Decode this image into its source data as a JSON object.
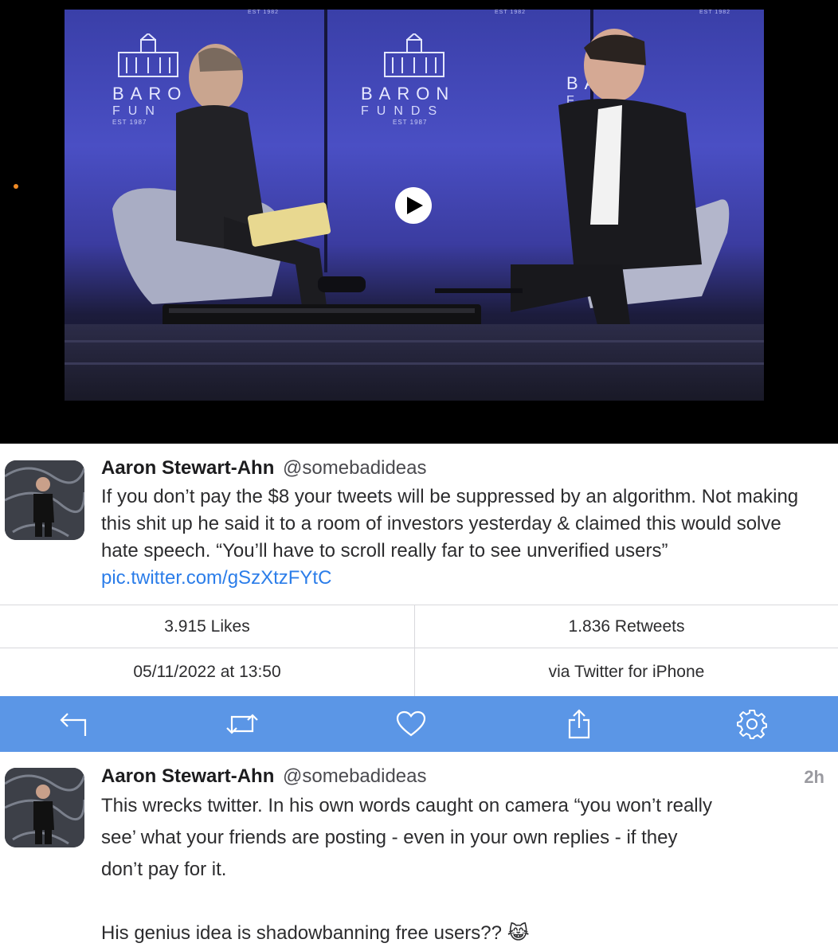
{
  "video": {
    "brand_word": "BARON",
    "brand_sub": "FUNDS",
    "brand_est": "EST 1987",
    "top_est": "EST 1982",
    "brand_word_partial_left": "BARO",
    "brand_sub_partial_left": "FUN",
    "brand_word_partial_right": "BA  N",
    "brand_sub_partial_right": "F",
    "play_icon": "play-icon"
  },
  "tweet_main": {
    "author_name": "Aaron Stewart-Ahn",
    "author_handle": "@somebadideas",
    "text": "If you don’t pay the $8 your tweets will be suppressed by an algorithm. Not making this shit up he said it to a room of investors yesterday & claimed this would solve hate speech. “You’ll have to scroll really far to see unverified users”",
    "link": "pic.twitter.com/gSzXtzFYtC"
  },
  "stats": {
    "likes": "3.915 Likes",
    "retweets": "1.836 Retweets",
    "date": "05/11/2022 at 13:50",
    "via": "via Twitter for iPhone"
  },
  "actions": {
    "reply_icon": "reply-icon",
    "retweet_icon": "retweet-icon",
    "like_icon": "heart-icon",
    "share_icon": "share-icon",
    "settings_icon": "gear-icon"
  },
  "tweet_reply": {
    "author_name": "Aaron Stewart-Ahn",
    "author_handle": "@somebadideas",
    "time": "2h",
    "line1": "This wrecks twitter. In his own words caught on camera “you won’t really",
    "line2": "see’ what your friends are posting - even in your own replies - if they",
    "line3": "don’t pay for it.",
    "line4": "His genius idea is shadowbanning free users?? 😹"
  },
  "colors": {
    "action_bar": "#5b96e6",
    "link": "#2b7de9",
    "stage_blue": "#4a4fc4"
  }
}
